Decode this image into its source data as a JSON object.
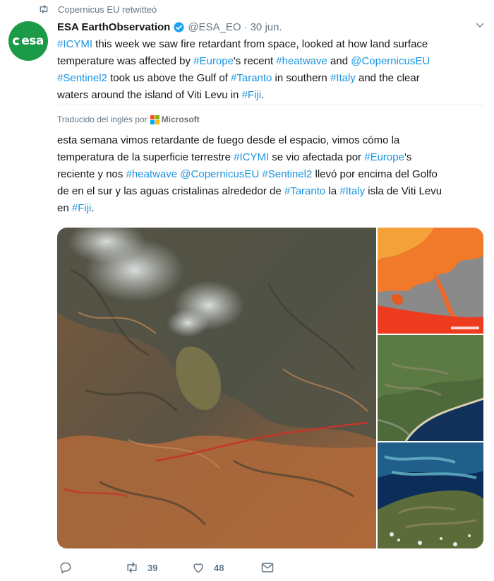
{
  "retweet": {
    "label": "Copernicus EU retwitteó"
  },
  "author": {
    "name": "ESA EarthObservation",
    "handle": "@ESA_EO",
    "separator": "·",
    "date": "30 jun.",
    "avatar_text": "esa"
  },
  "tweet_lines": [
    [
      {
        "t": "#ICYMI",
        "tag": true
      },
      {
        "t": " this week we saw fire retardant from space, looked at how land surface"
      }
    ],
    [
      {
        "t": "temperature was affected by "
      },
      {
        "t": "#Europe",
        "tag": true
      },
      {
        "t": "'s recent "
      },
      {
        "t": "#heatwave",
        "tag": true
      },
      {
        "t": " and "
      },
      {
        "t": "@CopernicusEU",
        "tag": true
      }
    ],
    [
      {
        "t": "#Sentinel2",
        "tag": true
      },
      {
        "t": " took us above the Gulf of "
      },
      {
        "t": "#Taranto",
        "tag": true
      },
      {
        "t": " in southern "
      },
      {
        "t": "#Italy",
        "tag": true
      },
      {
        "t": " and the clear"
      }
    ],
    [
      {
        "t": "waters around the island of Viti Levu in "
      },
      {
        "t": "#Fiji",
        "tag": true
      },
      {
        "t": "."
      }
    ]
  ],
  "translation": {
    "label": "Traducido del inglés por",
    "provider": "Microsoft"
  },
  "translation_lines": [
    [
      {
        "t": "esta semana vimos retardante de fuego desde el espacio, vimos cómo la"
      }
    ],
    [
      {
        "t": "temperatura de la superficie terrestre "
      },
      {
        "t": "#ICYMI",
        "tag": true
      },
      {
        "t": " se vio afectada por "
      },
      {
        "t": "#Europe",
        "tag": true
      },
      {
        "t": "'s"
      }
    ],
    [
      {
        "t": "reciente y nos "
      },
      {
        "t": "#heatwave",
        "tag": true
      },
      {
        "t": " "
      },
      {
        "t": "@CopernicusEU",
        "tag": true
      },
      {
        "t": " "
      },
      {
        "t": "#Sentinel2",
        "tag": true
      },
      {
        "t": " llevó por encima del Golfo"
      }
    ],
    [
      {
        "t": "de en el sur y las aguas cristalinas alrededor de "
      },
      {
        "t": "#Taranto",
        "tag": true
      },
      {
        "t": " la "
      },
      {
        "t": "#Italy",
        "tag": true
      },
      {
        "t": " isla de Viti Levu"
      }
    ],
    [
      {
        "t": "en "
      },
      {
        "t": "#Fiji",
        "tag": true
      },
      {
        "t": "."
      }
    ]
  ],
  "actions": {
    "reply_count": "",
    "retweet_count": "39",
    "like_count": "48"
  },
  "colors": {
    "accent": "#1b95e0",
    "muted": "#657786",
    "esa_green": "#1b9a47",
    "verified": "#1da1f2"
  },
  "icons": {
    "retweet": "retweet-icon",
    "verified": "verified-badge-icon",
    "chevron": "chevron-down-icon",
    "reply": "reply-icon",
    "like": "heart-icon",
    "dm": "envelope-icon"
  }
}
